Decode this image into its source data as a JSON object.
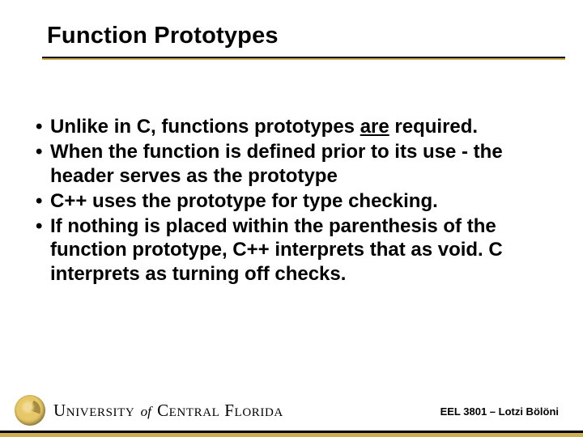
{
  "title": "Function Prototypes",
  "bullets": [
    {
      "pre": "Unlike in C, functions prototypes ",
      "u": "are",
      "post": " required."
    },
    {
      "pre": "When the function is defined prior to its use - the header serves as the prototype",
      "u": "",
      "post": ""
    },
    {
      "pre": "C++ uses the prototype for type checking.",
      "u": "",
      "post": ""
    },
    {
      "pre": "If nothing is placed within the parenthesis of the function prototype, C++ interprets that as void.  C interprets as turning off checks.",
      "u": "",
      "post": ""
    }
  ],
  "footer": {
    "course": "EEL 3801 – Lotzi Bölöni",
    "brand_word1": "University",
    "brand_of": "of",
    "brand_word2": "Central Florida"
  }
}
